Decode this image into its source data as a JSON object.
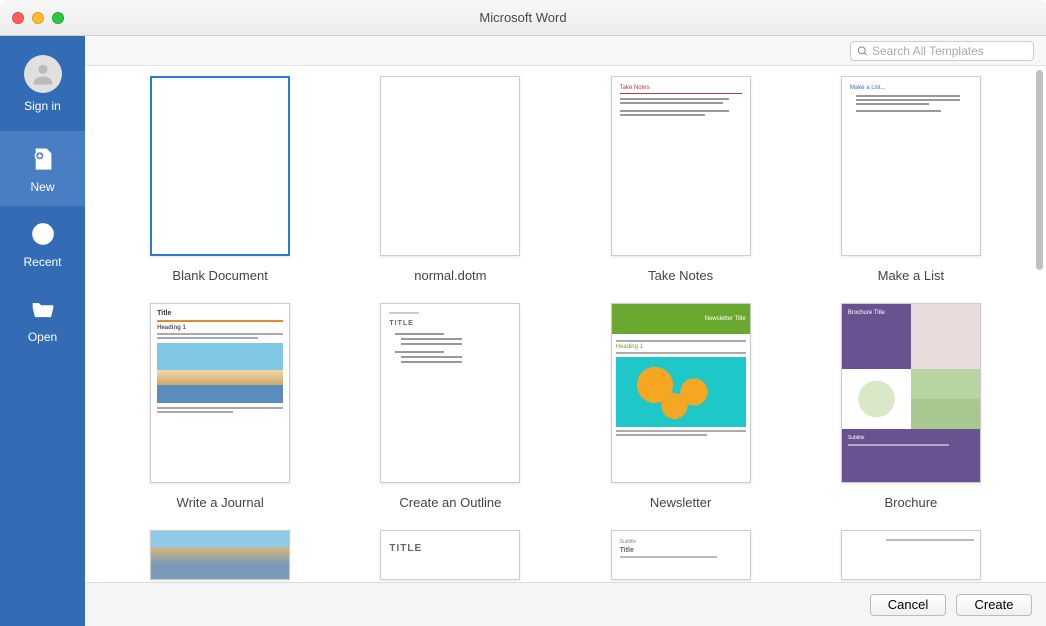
{
  "window": {
    "title": "Microsoft Word"
  },
  "sidebar": {
    "signin": "Sign in",
    "new": "New",
    "recent": "Recent",
    "open": "Open"
  },
  "search": {
    "placeholder": "Search All Templates"
  },
  "templates": [
    {
      "id": "blank",
      "label": "Blank Document",
      "selected": true
    },
    {
      "id": "normal",
      "label": "normal.dotm"
    },
    {
      "id": "takenotes",
      "label": "Take Notes",
      "preview_heading": "Take Notes"
    },
    {
      "id": "makealist",
      "label": "Make a List",
      "preview_heading": "Make a List..."
    },
    {
      "id": "journal",
      "label": "Write a Journal",
      "preview_title": "Title",
      "preview_heading": "Heading 1"
    },
    {
      "id": "outline",
      "label": "Create an Outline",
      "preview_title": "TITLE"
    },
    {
      "id": "newsletter",
      "label": "Newsletter",
      "preview_banner": "Newsletter Title",
      "preview_heading": "Heading 1"
    },
    {
      "id": "brochure",
      "label": "Brochure",
      "preview_title": "Brochure Title",
      "preview_subtitle": "Subtitle"
    },
    {
      "id": "row3a",
      "label": ""
    },
    {
      "id": "row3b",
      "label": "",
      "preview_title": "TITLE"
    },
    {
      "id": "row3c",
      "label": "",
      "preview_sub": "Subtitle",
      "preview_title": "Title"
    },
    {
      "id": "row3d",
      "label": ""
    }
  ],
  "footer": {
    "cancel": "Cancel",
    "create": "Create"
  }
}
